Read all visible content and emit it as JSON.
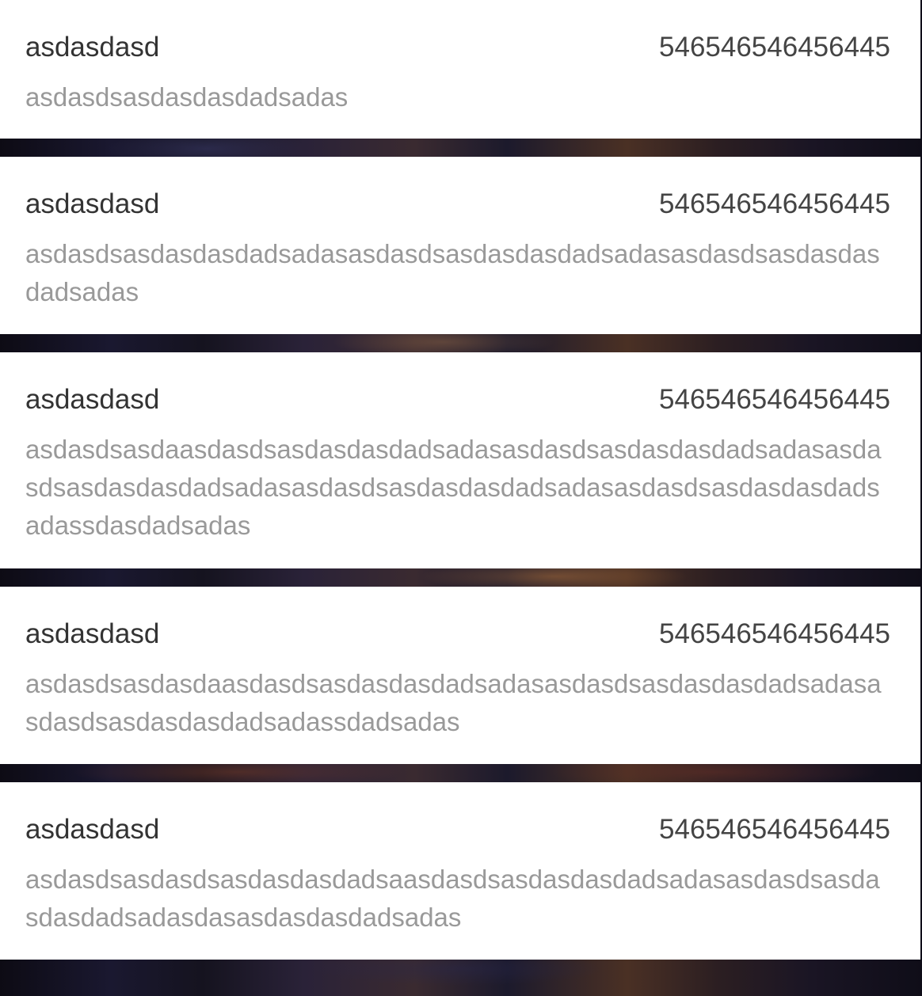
{
  "items": [
    {
      "name": "asdasdasd",
      "number": "546546546456445",
      "description": "asdasdsasdasdasdadsadas"
    },
    {
      "name": "asdasdasd",
      "number": "546546546456445",
      "description": "asdasdsasdasdasdadsadasasdasdsasdasdasdadsadasasdasdsasdasdasdadsadas"
    },
    {
      "name": "asdasdasd",
      "number": "546546546456445",
      "description": "asdasdsasdaasdasdsasdasdasdadsadasasdasdsasdasdasdadsadasasdasdsasdasdasdadsadasasdasdsasdasdasdadsadasasdasdsasdasdasdadsadassdasdadsadas"
    },
    {
      "name": "asdasdasd",
      "number": "546546546456445",
      "description": "asdasdsasdasdaasdasdsasdasdasdadsadasasdasdsasdasdasdadsadasasdasdsasdasdasdadsadassdadsadas"
    },
    {
      "name": "asdasdasd",
      "number": "546546546456445",
      "description": "asdasdsasdasdsasdasdasdadsaasdasdsasdasdasdadsadasasdasdsasdasdasdadsadasdasasdasdasdadsadas"
    }
  ]
}
